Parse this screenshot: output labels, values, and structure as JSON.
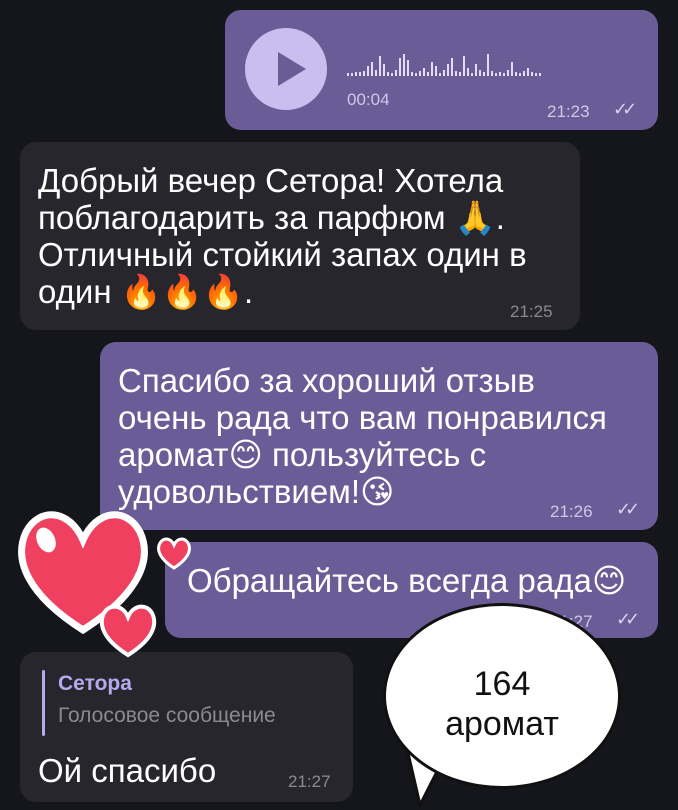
{
  "messages": {
    "voice": {
      "duration": "00:04",
      "time": "21:23",
      "status_icon": "double-check-icon"
    },
    "m1": {
      "text": "Добрый вечер Сетора! Хотела\nпоблагодарить за парфюм 🙏.\nОтличный стойкий запах один в\nодин 🔥🔥🔥.",
      "time": "21:25"
    },
    "m2": {
      "text": "Спасибо за хороший отзыв\nочень рада что вам понравился\nаромат😊 пользуйтесь с\nудовольствием!😘",
      "time": "21:26"
    },
    "m3": {
      "text": "Обращайтесь всегда рада😊",
      "time": "21:27"
    },
    "m4": {
      "reply_name": "Сетора",
      "reply_text": "Голосовое сообщение",
      "text": "Ой спасибо",
      "time": "21:27"
    }
  },
  "overlay": {
    "speech_text": "164\nаромат"
  },
  "colors": {
    "outgoing": "#6a5c96",
    "incoming": "#26262c",
    "background": "#15161c",
    "heart": "#f0405f"
  }
}
